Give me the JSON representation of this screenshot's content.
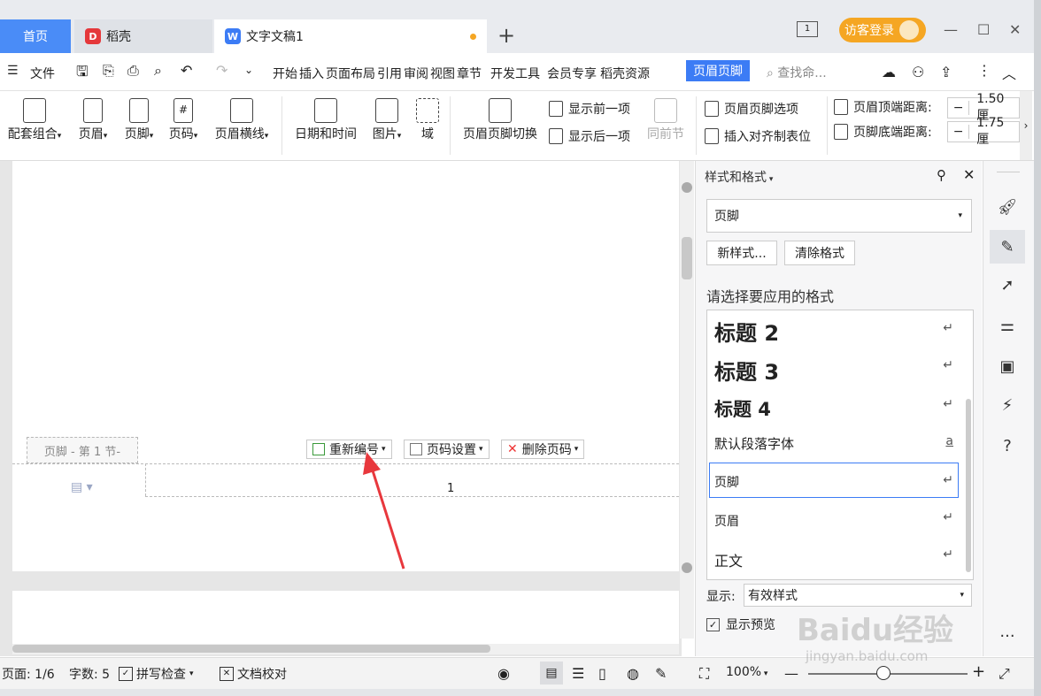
{
  "tabs": {
    "home": "首页",
    "daoke": "稻壳",
    "doc": "文字文稿1"
  },
  "visitor_login": "访客登录",
  "menubar": {
    "file": "文件",
    "items": [
      "开始",
      "插入",
      "页面布局",
      "引用",
      "审阅",
      "视图",
      "章节",
      "开发工具",
      "会员专享",
      "稻壳资源"
    ],
    "active": "页眉页脚",
    "search_placeholder": "查找命..."
  },
  "ribbon": {
    "suite": "配套组合",
    "header": "页眉",
    "footer": "页脚",
    "page_number": "页码",
    "header_line": "页眉横线",
    "datetime": "日期和时间",
    "picture": "图片",
    "field": "域",
    "switch": "页眉页脚切换",
    "show_prev": "显示前一项",
    "show_next": "显示后一项",
    "same_prev": "同前节",
    "hf_options": "页眉页脚选项",
    "insert_tab": "插入对齐制表位",
    "header_top_label": "页眉顶端距离:",
    "header_top_value": "1.50厘",
    "footer_bottom_label": "页脚底端距离:",
    "footer_bottom_value": "1.75厘"
  },
  "document": {
    "footer_label": "页脚 - 第 1 节-",
    "renumber": "重新编号",
    "page_setting": "页码设置",
    "delete_page_num": "删除页码",
    "page_number": "1"
  },
  "panel": {
    "title": "样式和格式",
    "current_style": "页脚",
    "new_style": "新样式...",
    "clear_format": "清除格式",
    "subtitle": "请选择要应用的格式",
    "styles": [
      "标题 2",
      "标题 3",
      "标题 4",
      "默认段落字体",
      "页脚",
      "页眉",
      "正文"
    ],
    "display_label": "显示:",
    "display_value": "有效样式",
    "show_preview": "显示预览"
  },
  "statusbar": {
    "page": "页面: 1/6",
    "words": "字数: 5",
    "spell": "拼写检查",
    "proof": "文档校对",
    "zoom": "100%"
  },
  "watermark": {
    "brand": "Baidu经验",
    "url": "jingyan.baidu.com"
  },
  "colors": {
    "accent": "#3c7cf5",
    "home_tab": "#4a8cf7",
    "visitor": "#f5a623",
    "arrow": "#e8383d"
  }
}
